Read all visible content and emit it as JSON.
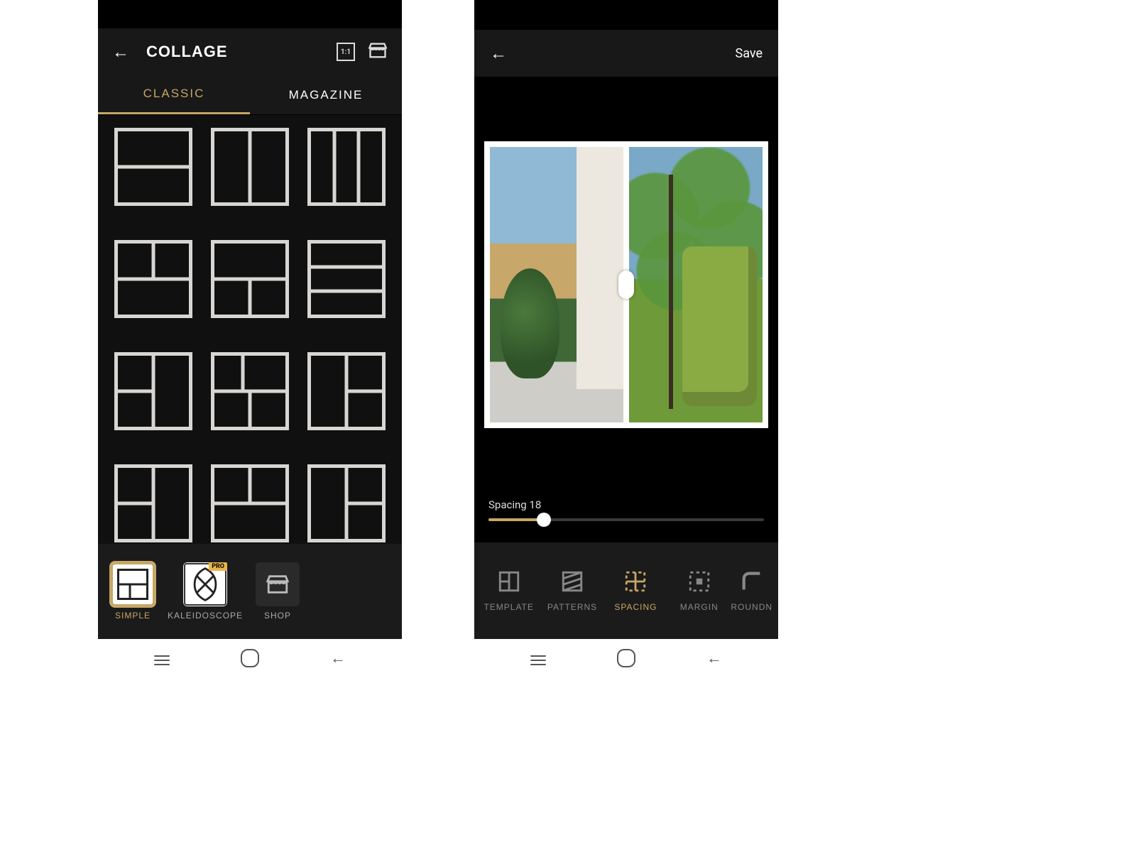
{
  "left": {
    "header": {
      "title": "COLLAGE",
      "ratio_label": "1:1"
    },
    "tabs": {
      "classic": "CLASSIC",
      "magazine": "MAGAZINE"
    },
    "bottom": {
      "simple": "SIMPLE",
      "kaleidoscope": "KALEIDOSCOPE",
      "pro_badge": "PRO",
      "shop": "SHOP"
    }
  },
  "right": {
    "header": {
      "save": "Save"
    },
    "spacing": {
      "label": "Spacing 18",
      "value": 18
    },
    "tools": {
      "template": "TEMPLATE",
      "patterns": "PATTERNS",
      "spacing": "SPACING",
      "margin": "MARGIN",
      "roundness": "ROUNDN"
    }
  }
}
